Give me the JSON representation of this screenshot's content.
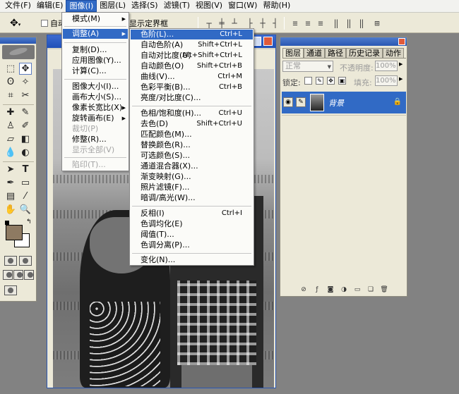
{
  "menubar": {
    "items": [
      "文件(F)",
      "编辑(E)",
      "图像(I)",
      "图层(L)",
      "选择(S)",
      "滤镜(T)",
      "视图(V)",
      "窗口(W)",
      "帮助(H)"
    ],
    "active": "图像(I)"
  },
  "options": {
    "auto_label": "自动",
    "show_bounds_label": "显示定界框"
  },
  "image_menu": {
    "items": [
      {
        "label": "模式(M)",
        "submenu": true,
        "disabled": false
      },
      {
        "label": "调整(A)",
        "submenu": true,
        "disabled": false,
        "highlight": true
      },
      {
        "label": "复制(D)...",
        "disabled": false
      },
      {
        "label": "应用图像(Y)...",
        "disabled": false
      },
      {
        "label": "计算(C)...",
        "disabled": false
      },
      {
        "label": "图像大小(I)...",
        "disabled": false
      },
      {
        "label": "画布大小(S)...",
        "disabled": false
      },
      {
        "label": "像素长宽比(X)",
        "submenu": true,
        "disabled": false
      },
      {
        "label": "旋转画布(E)",
        "submenu": true,
        "disabled": false
      },
      {
        "label": "裁切(P)",
        "disabled": true
      },
      {
        "label": "修整(R)...",
        "disabled": false
      },
      {
        "label": "显示全部(V)",
        "disabled": true
      },
      {
        "label": "陷印(T)...",
        "disabled": true
      }
    ]
  },
  "adjust_menu": {
    "items": [
      {
        "label": "色阶(L)...",
        "shortcut": "Ctrl+L",
        "highlight": true
      },
      {
        "label": "自动色阶(A)",
        "shortcut": "Shift+Ctrl+L"
      },
      {
        "label": "自动对比度(U)",
        "shortcut": "Alt+Shift+Ctrl+L"
      },
      {
        "label": "自动颜色(O)",
        "shortcut": "Shift+Ctrl+B"
      },
      {
        "label": "曲线(V)...",
        "shortcut": "Ctrl+M"
      },
      {
        "label": "色彩平衡(B)...",
        "shortcut": "Ctrl+B"
      },
      {
        "label": "亮度/对比度(C)...",
        "shortcut": ""
      },
      {
        "label": "色相/饱和度(H)...",
        "shortcut": "Ctrl+U"
      },
      {
        "label": "去色(D)",
        "shortcut": "Shift+Ctrl+U"
      },
      {
        "label": "匹配颜色(M)...",
        "shortcut": ""
      },
      {
        "label": "替换颜色(R)...",
        "shortcut": ""
      },
      {
        "label": "可选颜色(S)...",
        "shortcut": ""
      },
      {
        "label": "通道混合器(X)...",
        "shortcut": ""
      },
      {
        "label": "渐变映射(G)...",
        "shortcut": ""
      },
      {
        "label": "照片滤镜(F)...",
        "shortcut": ""
      },
      {
        "label": "暗调/高光(W)...",
        "shortcut": ""
      },
      {
        "label": "反相(I)",
        "shortcut": "Ctrl+I"
      },
      {
        "label": "色调均化(E)",
        "shortcut": ""
      },
      {
        "label": "阈值(T)...",
        "shortcut": ""
      },
      {
        "label": "色调分离(P)...",
        "shortcut": ""
      },
      {
        "label": "变化(N)...",
        "shortcut": ""
      }
    ]
  },
  "layers_panel": {
    "tabs": [
      "图层",
      "通道",
      "路径",
      "历史记录",
      "动作"
    ],
    "blend_mode": "正常",
    "opacity_label": "不透明度:",
    "opacity_value": "100%",
    "lock_label": "锁定:",
    "fill_label": "填充:",
    "fill_value": "100%",
    "layer_name": "背景"
  },
  "colors": {
    "foreground": "#8e7a62",
    "background": "#ffffff",
    "highlight": "#316ac5"
  }
}
